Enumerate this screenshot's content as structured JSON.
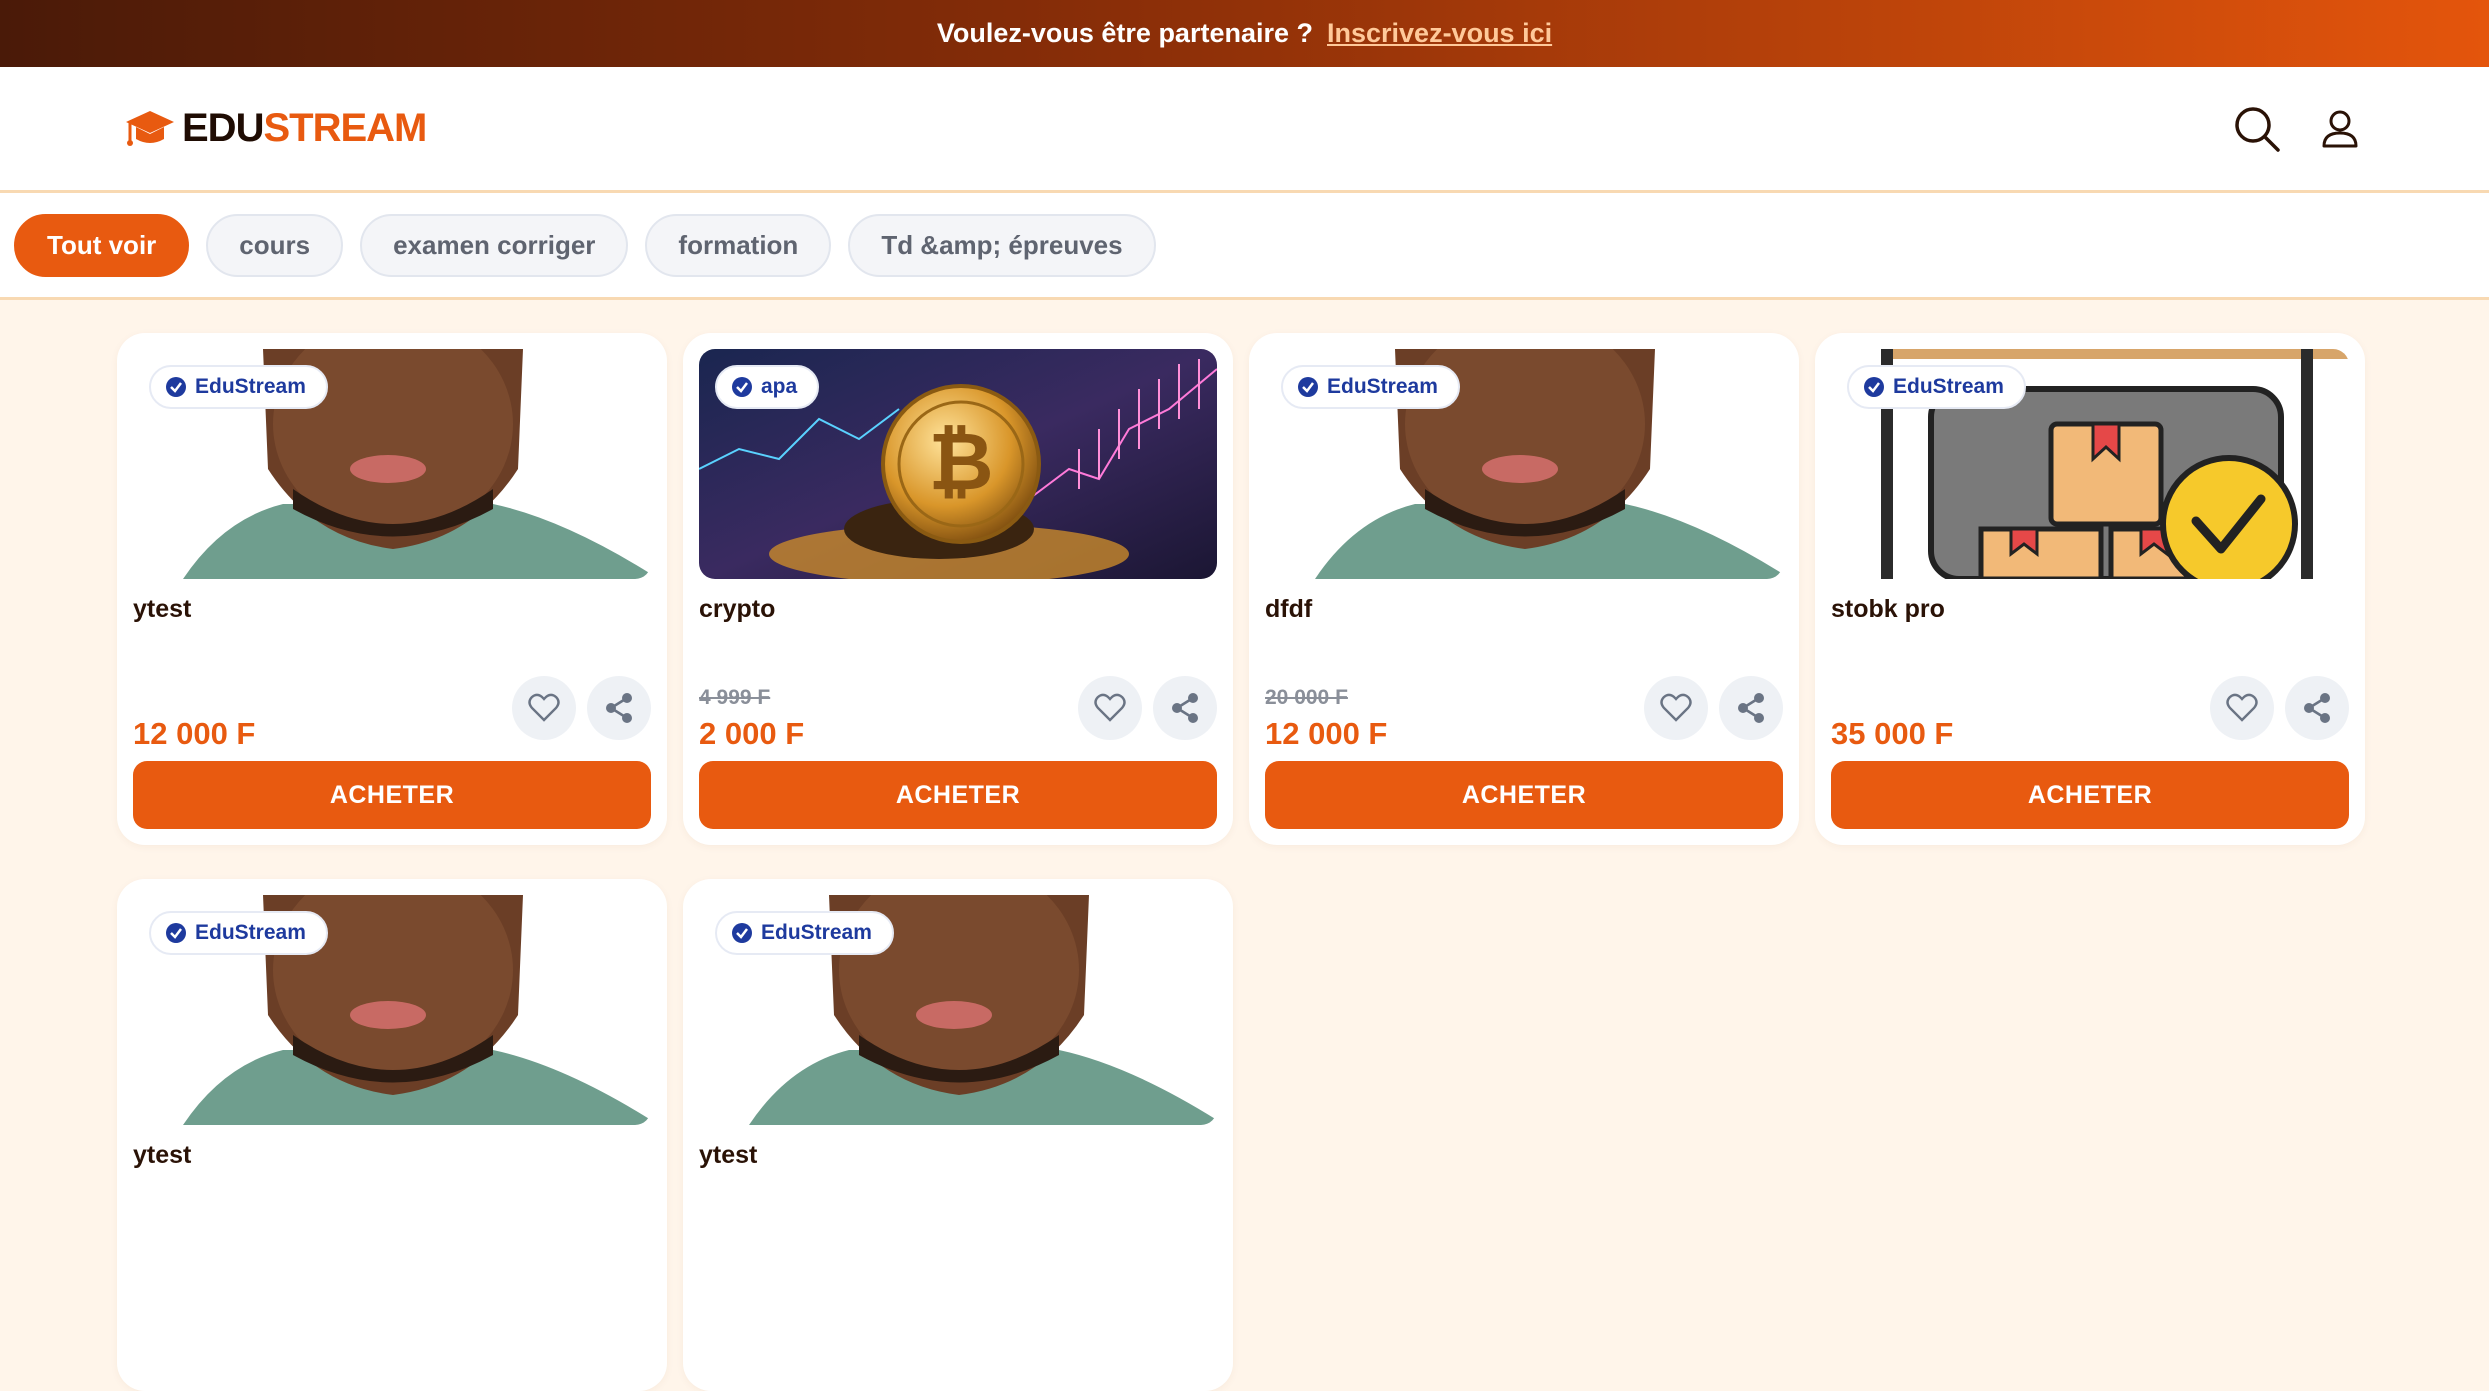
{
  "promo": {
    "text": "Voulez-vous être partenaire ?",
    "link": "Inscrivez-vous ici"
  },
  "header": {
    "logo_edu": "EDU",
    "logo_stream": "STREAM",
    "search_icon": "search-icon",
    "user_icon": "user-icon"
  },
  "filters": [
    "Tout voir",
    "cours",
    "examen corriger",
    "formation",
    "Td &amp; épreuves"
  ],
  "buy_label": "ACHETER",
  "colors": {
    "accent": "#e85a10",
    "badge": "#1e3a9e"
  },
  "products": [
    {
      "badge": "EduStream",
      "title": "ytest",
      "old_price": "",
      "price": "12 000 F",
      "image": "portrait"
    },
    {
      "badge": "apa",
      "title": "crypto",
      "old_price": "4 999 F",
      "price": "2 000 F",
      "image": "bitcoin"
    },
    {
      "badge": "EduStream",
      "title": "dfdf",
      "old_price": "20 000 F",
      "price": "12 000 F",
      "image": "portrait"
    },
    {
      "badge": "EduStream",
      "title": "stobk pro",
      "old_price": "",
      "price": "35 000 F",
      "image": "stock"
    },
    {
      "badge": "EduStream",
      "title": "ytest",
      "old_price": "",
      "price": "",
      "image": "portrait"
    },
    {
      "badge": "EduStream",
      "title": "ytest",
      "old_price": "",
      "price": "",
      "image": "portrait"
    }
  ]
}
